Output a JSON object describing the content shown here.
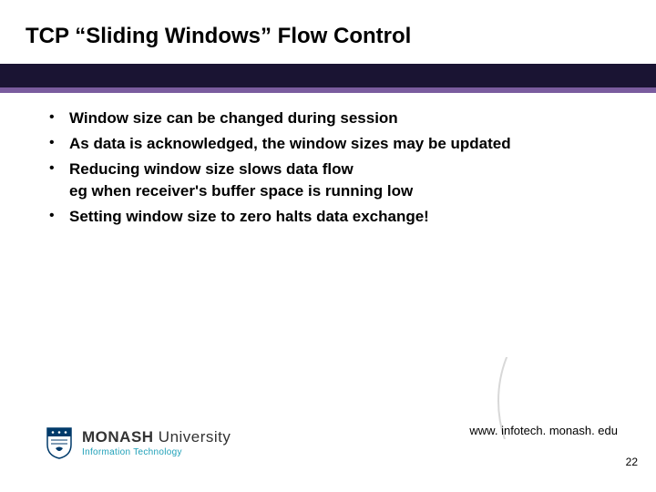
{
  "title": "TCP “Sliding Windows” Flow Control",
  "bullets": [
    "Window size can be changed during session",
    "As data is acknowledged, the window sizes may be updated",
    "Reducing window size slows data flow\neg when receiver's buffer space is running low",
    "Setting window size to zero halts data exchange!"
  ],
  "logo": {
    "main_bold": "MONASH",
    "main_light": " University",
    "sub": "Information Technology"
  },
  "url": "www. infotech. monash. edu",
  "page_number": "22"
}
